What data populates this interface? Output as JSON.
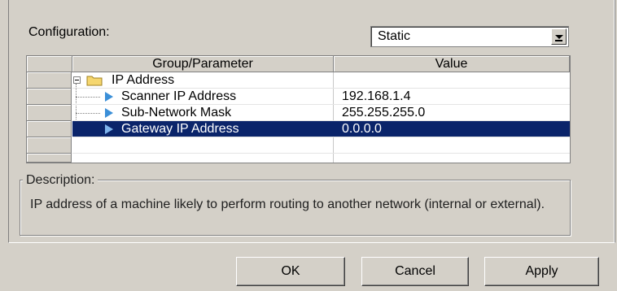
{
  "configuration": {
    "label": "Configuration:",
    "selected": "Static"
  },
  "grid": {
    "headers": {
      "group": "Group/Parameter",
      "value": "Value"
    },
    "rows": [
      {
        "name": "IP Address",
        "value": "",
        "type": "group"
      },
      {
        "name": "Scanner IP Address",
        "value": "192.168.1.4",
        "type": "param"
      },
      {
        "name": "Sub-Network Mask",
        "value": "255.255.255.0",
        "type": "param"
      },
      {
        "name": "Gateway IP Address",
        "value": "0.0.0.0",
        "type": "param",
        "selected": true
      }
    ]
  },
  "description": {
    "label": "Description:",
    "text": "IP address of a machine likely to perform routing to another network (internal or external)."
  },
  "buttons": {
    "ok": "OK",
    "cancel": "Cancel",
    "apply": "Apply"
  },
  "colors": {
    "selection": "#0a246a",
    "param_icon": "#3b8fd8",
    "folder": "#f5d66e"
  }
}
